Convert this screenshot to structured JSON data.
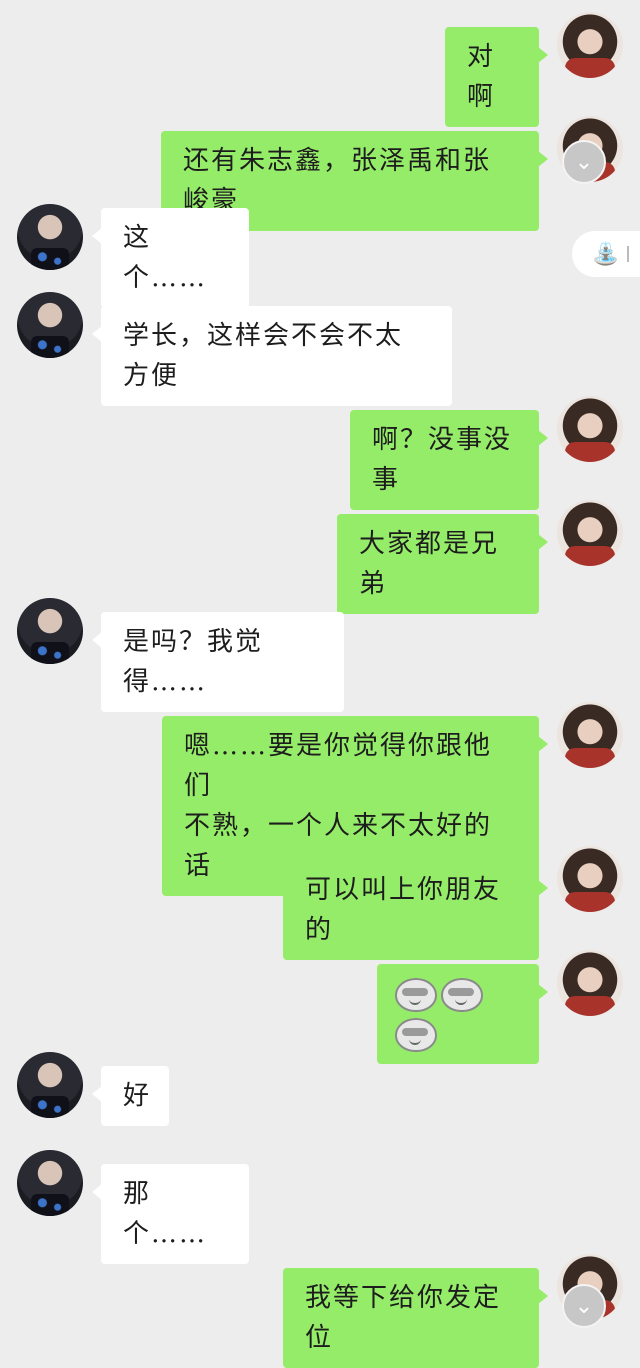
{
  "messages": [
    {
      "side": "out",
      "text": "对啊"
    },
    {
      "side": "out",
      "text": "还有朱志鑫，张泽禹和张峻豪"
    },
    {
      "side": "in",
      "text": "这个……"
    },
    {
      "side": "in",
      "text": "学长，这样会不会不太方便"
    },
    {
      "side": "out",
      "text": "啊？没事没事"
    },
    {
      "side": "out",
      "text": "大家都是兄弟"
    },
    {
      "side": "in",
      "text": "是吗？我觉得……"
    },
    {
      "side": "out",
      "text_line1": "嗯……要是你觉得你跟他们",
      "text_line2": "不熟，一个人来不太好的话"
    },
    {
      "side": "out",
      "text": "可以叫上你朋友的"
    },
    {
      "side": "out",
      "emoji_count": 3,
      "emoji_icon": "smirk-sunglasses-emoji"
    },
    {
      "side": "in",
      "text": "好"
    },
    {
      "side": "in",
      "text": "那个……"
    },
    {
      "side": "out",
      "text": "我等下给你发定位"
    }
  ],
  "scroll_down_icon": "chevron-down-icon",
  "floating_tab_icon": "fountain-icon",
  "colors": {
    "outgoing": "#95ec69",
    "incoming": "#ffffff",
    "background": "#ededed"
  }
}
